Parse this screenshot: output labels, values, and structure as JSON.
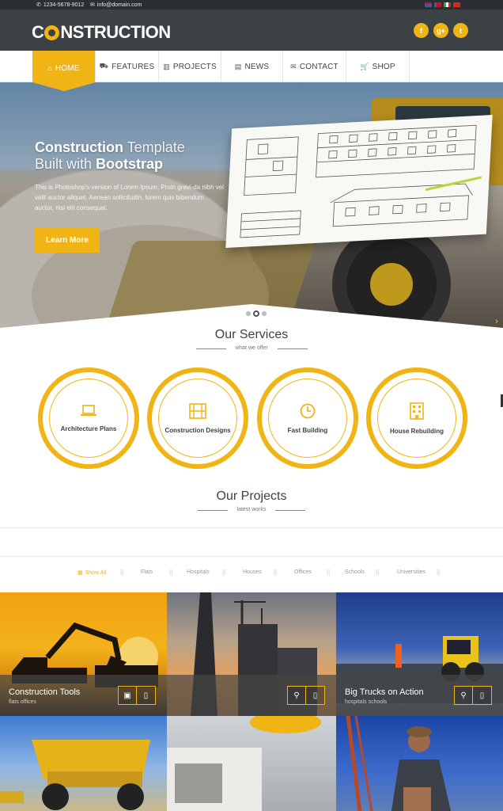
{
  "topbar": {
    "phone": "1234-5678-9012",
    "email": "info@domain.com",
    "flags": [
      "#c8102e",
      "#3b5da7",
      "#e0e0e0",
      "#d52b1e"
    ]
  },
  "brand": {
    "logo_pre": "C",
    "logo_post": "NSTRUCTION",
    "accent": "#f0b515",
    "dark": "#3c4146"
  },
  "social": [
    "f",
    "g+",
    "t"
  ],
  "nav": [
    {
      "label": "HOME",
      "icon": "home-icon",
      "glyph": "⌂",
      "active": true
    },
    {
      "label": "FEATURES",
      "icon": "truck-icon",
      "glyph": "⛟",
      "active": false
    },
    {
      "label": "PROJECTS",
      "icon": "building-icon",
      "glyph": "▥",
      "active": false
    },
    {
      "label": "NEWS",
      "icon": "newspaper-icon",
      "glyph": "▤",
      "active": false
    },
    {
      "label": "CONTACT",
      "icon": "envelope-icon",
      "glyph": "✉",
      "active": false
    },
    {
      "label": "SHOP",
      "icon": "cart-icon",
      "glyph": "🛒",
      "active": false
    }
  ],
  "hero": {
    "title_bold": "Construction",
    "title_thin": " Template",
    "line2_thin": "Built with ",
    "line2_bold": "Bootstrap",
    "text": "This is Photoshop's version of Lorem Ipsum. Proin gravi-da nibh vel velit auctor aliquet. Aenean sollicitudin, lorem quis bibendum auctor, nisi elit consequat.",
    "button": "Learn More",
    "slides": 3,
    "active_slide": 1
  },
  "services": {
    "title": "Our Services",
    "subtitle": "what we offer",
    "items": [
      {
        "label": "Architecture Plans",
        "icon": "laptop-icon",
        "glyph": "💻"
      },
      {
        "label": "Construction Designs",
        "icon": "film-icon",
        "glyph": "🎞"
      },
      {
        "label": "Fast Building",
        "icon": "clock-icon",
        "glyph": "🕘"
      },
      {
        "label": "House Rebuilding",
        "icon": "building-icon",
        "glyph": "🏢"
      }
    ]
  },
  "projects": {
    "title": "Our Projects",
    "subtitle": "latest works",
    "filters": [
      "Show All",
      "Flats",
      "Hospitals",
      "Houses",
      "Offices",
      "Schools",
      "Universities"
    ],
    "tiles": [
      {
        "title": "Construction Tools",
        "sub": "flats offices",
        "buttons": [
          "▣",
          "▯"
        ]
      },
      {
        "title": "",
        "sub": "",
        "buttons": [
          "⚲",
          "▯"
        ]
      },
      {
        "title": "Big Trucks on Action",
        "sub": "hospitals schools",
        "buttons": [
          "⚲",
          "▯"
        ]
      }
    ]
  }
}
